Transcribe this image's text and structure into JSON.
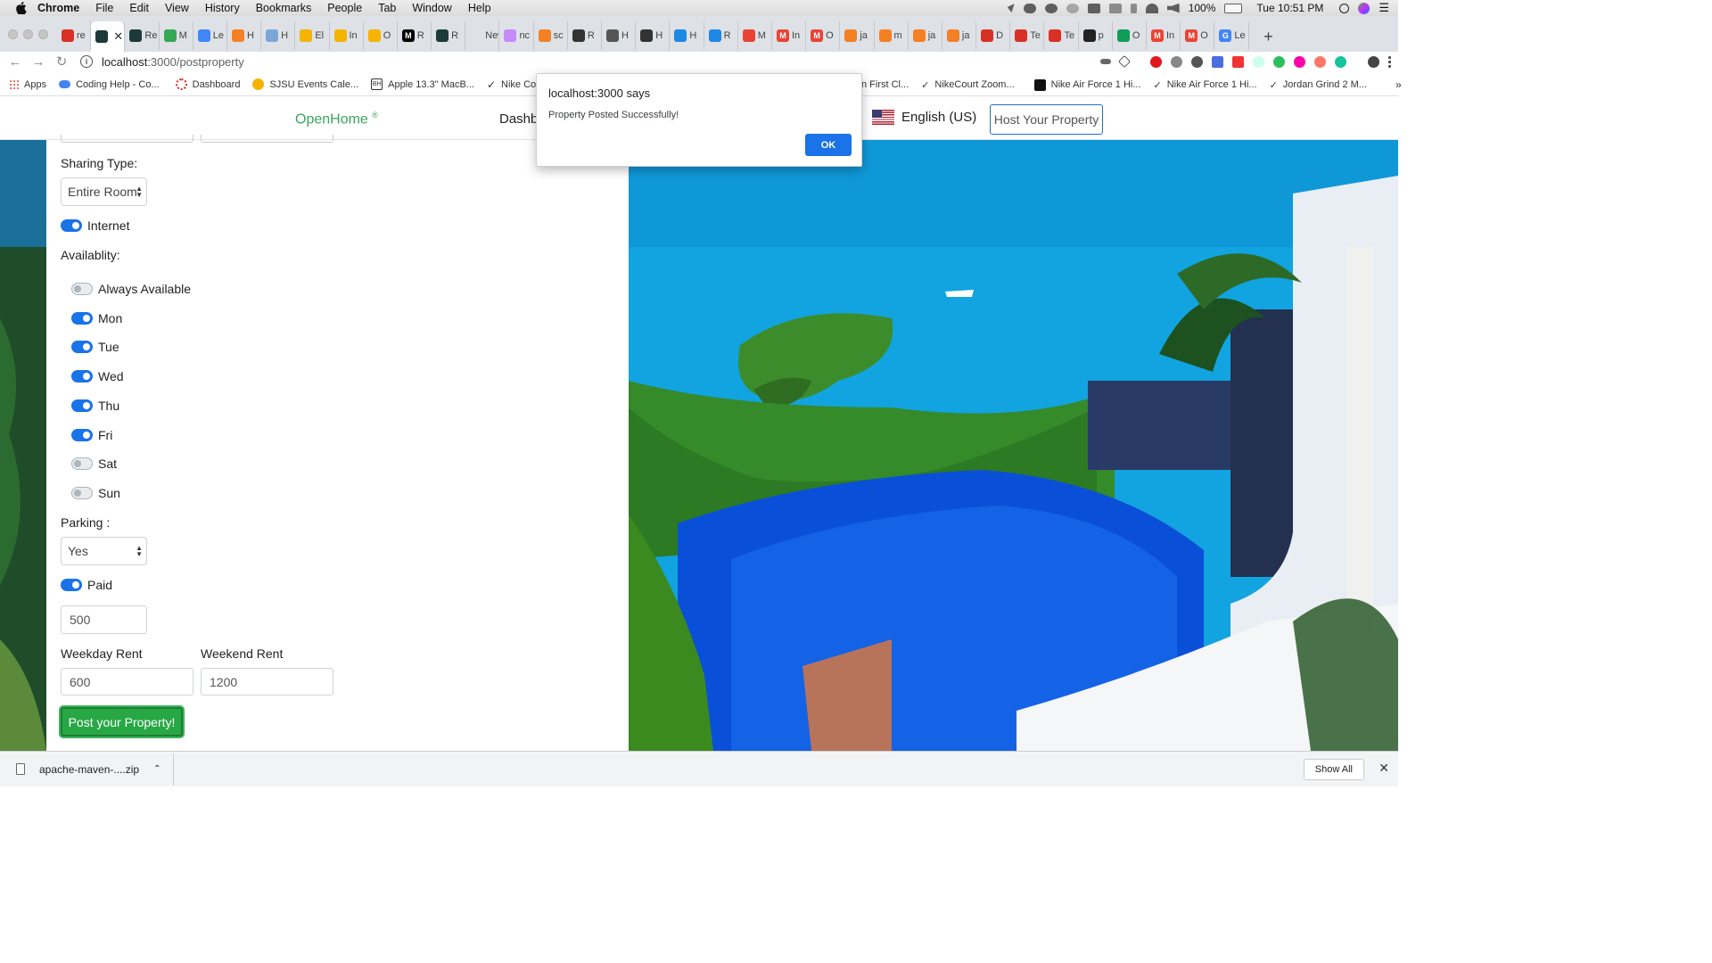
{
  "macos_menubar": {
    "app": "Chrome",
    "menus": [
      "File",
      "Edit",
      "View",
      "History",
      "Bookmarks",
      "People",
      "Tab",
      "Window",
      "Help"
    ],
    "battery": "100%",
    "clock": "Tue 10:51 PM"
  },
  "tabs": [
    {
      "label": "re",
      "color": "#d93025",
      "glyph": ""
    },
    {
      "label": "",
      "color": "#1c3a3a",
      "glyph": "",
      "active": true
    },
    {
      "label": "Re",
      "color": "#1c3a3a",
      "glyph": ""
    },
    {
      "label": "M",
      "color": "#34a853",
      "glyph": ""
    },
    {
      "label": "Le",
      "color": "#4285f4",
      "glyph": ""
    },
    {
      "label": "H",
      "color": "#f48024",
      "glyph": ""
    },
    {
      "label": "H",
      "color": "#7aa7d6",
      "glyph": ""
    },
    {
      "label": "El",
      "color": "#f4b400",
      "glyph": ""
    },
    {
      "label": "In",
      "color": "#f4b400",
      "glyph": ""
    },
    {
      "label": "O",
      "color": "#f4b400",
      "glyph": ""
    },
    {
      "label": "R",
      "color": "#000",
      "glyph": "M"
    },
    {
      "label": "R",
      "color": "#1c3a3a",
      "glyph": ""
    },
    {
      "label": "New T",
      "color": "",
      "glyph": ""
    },
    {
      "label": "nc",
      "color": "#c58af9",
      "glyph": ""
    },
    {
      "label": "sc",
      "color": "#f48024",
      "glyph": ""
    },
    {
      "label": "R",
      "color": "#333",
      "glyph": ""
    },
    {
      "label": "H",
      "color": "#555",
      "glyph": ""
    },
    {
      "label": "H",
      "color": "#333",
      "glyph": ""
    },
    {
      "label": "H",
      "color": "#1e88e5",
      "glyph": ""
    },
    {
      "label": "R",
      "color": "#1e88e5",
      "glyph": ""
    },
    {
      "label": "M",
      "color": "#ea4335",
      "glyph": ""
    },
    {
      "label": "In",
      "color": "#ea4335",
      "glyph": "M"
    },
    {
      "label": "O",
      "color": "#ea4335",
      "glyph": "M"
    },
    {
      "label": "ja",
      "color": "#f48024",
      "glyph": ""
    },
    {
      "label": "m",
      "color": "#f48024",
      "glyph": ""
    },
    {
      "label": "ja",
      "color": "#f48024",
      "glyph": ""
    },
    {
      "label": "ja",
      "color": "#f48024",
      "glyph": ""
    },
    {
      "label": "D",
      "color": "#d93025",
      "glyph": ""
    },
    {
      "label": "Te",
      "color": "#d93025",
      "glyph": ""
    },
    {
      "label": "Te",
      "color": "#d93025",
      "glyph": ""
    },
    {
      "label": "p",
      "color": "#222",
      "glyph": ""
    },
    {
      "label": "O",
      "color": "#0f9d58",
      "glyph": ""
    },
    {
      "label": "In",
      "color": "#ea4335",
      "glyph": "M"
    },
    {
      "label": "O",
      "color": "#ea4335",
      "glyph": "M"
    },
    {
      "label": "Le",
      "color": "#4285f4",
      "glyph": "G"
    }
  ],
  "address_bar": {
    "host": "localhost",
    "path": ":3000/postproperty"
  },
  "bookmarks": [
    {
      "label": "Apps",
      "color": "#ea4335"
    },
    {
      "label": "Coding Help - Co...",
      "color": "#4285f4"
    },
    {
      "label": "Dashboard",
      "color": "#d93025"
    },
    {
      "label": "SJSU Events Cale...",
      "color": "#f4b400"
    },
    {
      "label": "Apple 13.3\" MacB...",
      "color": "#333"
    },
    {
      "label": "Nike Cortez",
      "color": "#222"
    }
  ],
  "bookmarks_right": [
    {
      "label": "n First Cl...",
      "color": ""
    },
    {
      "label": "NikeCourt Zoom...",
      "color": "#222"
    },
    {
      "label": "Nike Air Force 1 Hi...",
      "color": "#222"
    },
    {
      "label": "Nike Air Force 1 Hi...",
      "color": "#222"
    },
    {
      "label": "Jordan Grind 2 M...",
      "color": "#222"
    }
  ],
  "site": {
    "brand": "OpenHome",
    "brand_mark": "®",
    "nav_dashboard": "Dashbo",
    "language": "English (US)",
    "host_button": "Host Your Property"
  },
  "form": {
    "sharing_type_label": "Sharing Type:",
    "sharing_type_value": "Entire Room",
    "internet_label": "Internet",
    "internet_on": true,
    "availability_label": "Availablity:",
    "availability": [
      {
        "label": "Always Available",
        "on": false
      },
      {
        "label": "Mon",
        "on": true
      },
      {
        "label": "Tue",
        "on": true
      },
      {
        "label": "Wed",
        "on": true
      },
      {
        "label": "Thu",
        "on": true
      },
      {
        "label": "Fri",
        "on": true
      },
      {
        "label": "Sat",
        "on": false
      },
      {
        "label": "Sun",
        "on": false
      }
    ],
    "parking_label": "Parking :",
    "parking_value": "Yes",
    "paid_label": "Paid",
    "paid_on": true,
    "parking_fee": "500",
    "weekday_rent_label": "Weekday Rent",
    "weekday_rent": "600",
    "weekend_rent_label": "Weekend Rent",
    "weekend_rent": "1200",
    "submit_label": "Post your Property!"
  },
  "alert": {
    "title": "localhost:3000 says",
    "message": "Property Posted Successfully!",
    "ok": "OK"
  },
  "downloads": {
    "file": "apache-maven-....zip",
    "show_all": "Show All"
  }
}
